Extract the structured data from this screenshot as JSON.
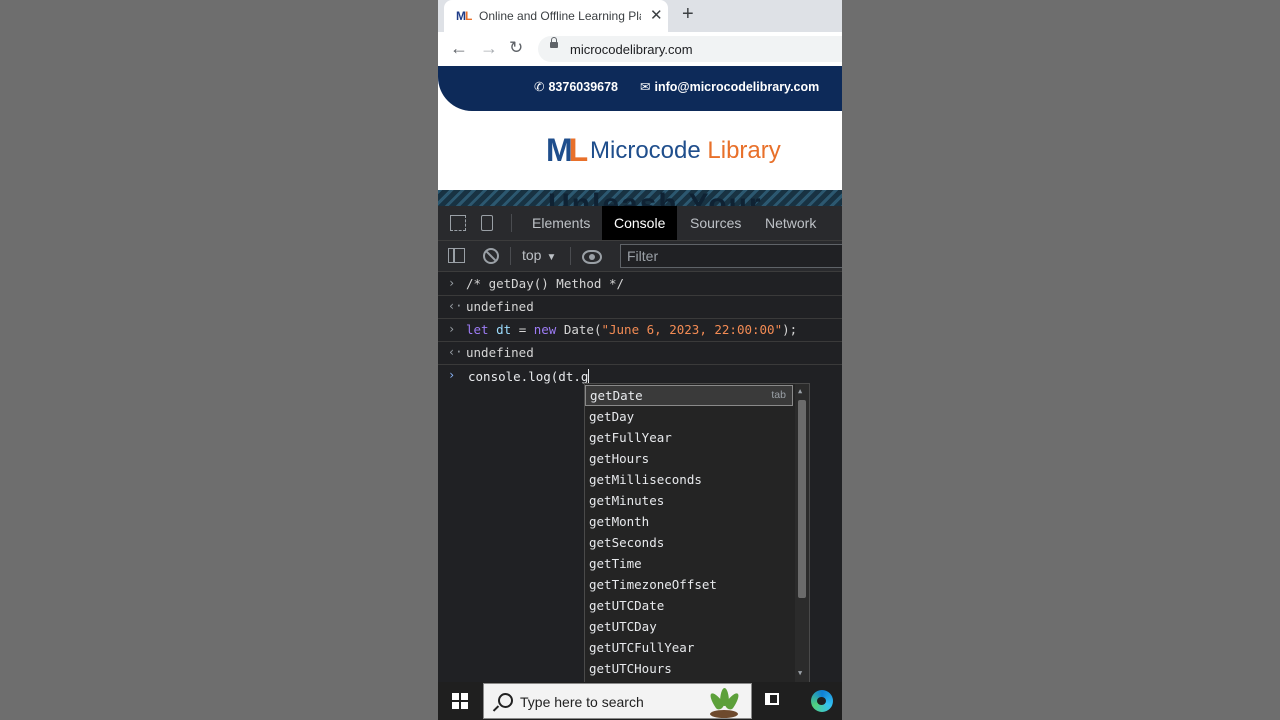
{
  "browser": {
    "tab_title": "Online and Offline Learning Platf",
    "favicon_m": "M",
    "favicon_l": "L",
    "close_glyph": "✕",
    "new_tab_glyph": "+",
    "back_glyph": "←",
    "forward_glyph": "→",
    "reload_glyph": "↻",
    "url": "microcodelibrary.com"
  },
  "site": {
    "phone_icon": "✆",
    "phone": "8376039678",
    "mail_icon": "✉",
    "email": "info@microcodelibrary.com",
    "logo_m": "M",
    "logo_l": "L",
    "logo_word1": "Microcode",
    "logo_word2": "Library",
    "hero_text": "Unleash Your"
  },
  "devtools": {
    "tabs": [
      "Elements",
      "Console",
      "Sources",
      "Network"
    ],
    "context": "top",
    "context_caret": "▼",
    "filter_placeholder": "Filter"
  },
  "console": {
    "input_glyph": "›",
    "output_glyph": "‹·",
    "lines": [
      {
        "type": "input",
        "comment": "/* getDay() Method */"
      },
      {
        "type": "output",
        "text": "undefined"
      },
      {
        "type": "input",
        "kw1": "let",
        "var": "dt",
        "op": " = ",
        "kw2": "new",
        "fn": " Date(",
        "str": "\"June 6, 2023, 22:00:00\"",
        "end": ");"
      },
      {
        "type": "output",
        "text": "undefined"
      }
    ],
    "prompt_text": "console.log(dt.g"
  },
  "autocomplete": {
    "hint": "tab",
    "items": [
      "getDate",
      "getDay",
      "getFullYear",
      "getHours",
      "getMilliseconds",
      "getMinutes",
      "getMonth",
      "getSeconds",
      "getTime",
      "getTimezoneOffset",
      "getUTCDate",
      "getUTCDay",
      "getUTCFullYear",
      "getUTCHours"
    ],
    "selected_index": 0,
    "arrow_up": "▲",
    "arrow_down": "▼"
  },
  "taskbar": {
    "search_placeholder": "Type here to search"
  }
}
